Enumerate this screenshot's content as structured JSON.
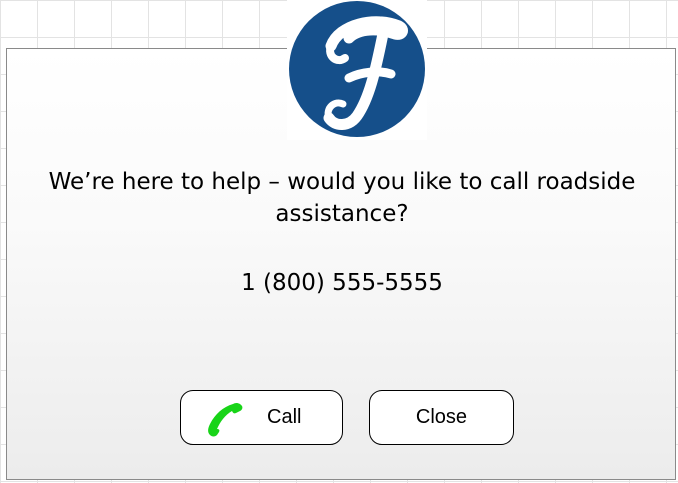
{
  "dialog": {
    "message": "We’re here to help – would you like to call roadside assistance?",
    "phone_number": "1 (800) 555-5555",
    "call_label": "Call",
    "close_label": "Close"
  },
  "icons": {
    "logo": "script-f-logo",
    "call": "phone-handset-icon"
  },
  "colors": {
    "logo_blue": "#154f8a",
    "call_green": "#18d418",
    "button_border": "#000000"
  }
}
